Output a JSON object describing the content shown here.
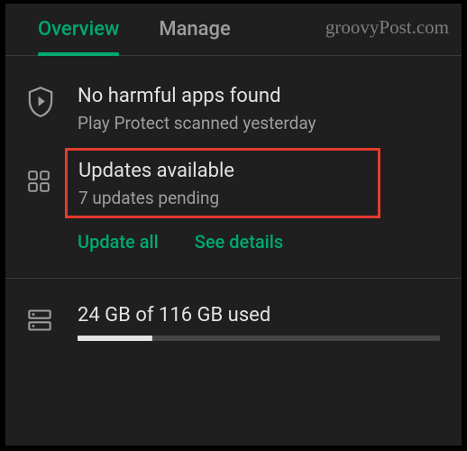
{
  "tabs": {
    "overview": "Overview",
    "manage": "Manage"
  },
  "watermark": "groovyPost.com",
  "protect": {
    "title": "No harmful apps found",
    "subtitle": "Play Protect scanned yesterday"
  },
  "updates": {
    "title": "Updates available",
    "subtitle": "7 updates pending",
    "update_all": "Update all",
    "see_details": "See details"
  },
  "storage": {
    "title": "24 GB of 116 GB used",
    "used": 24,
    "total": 116
  }
}
